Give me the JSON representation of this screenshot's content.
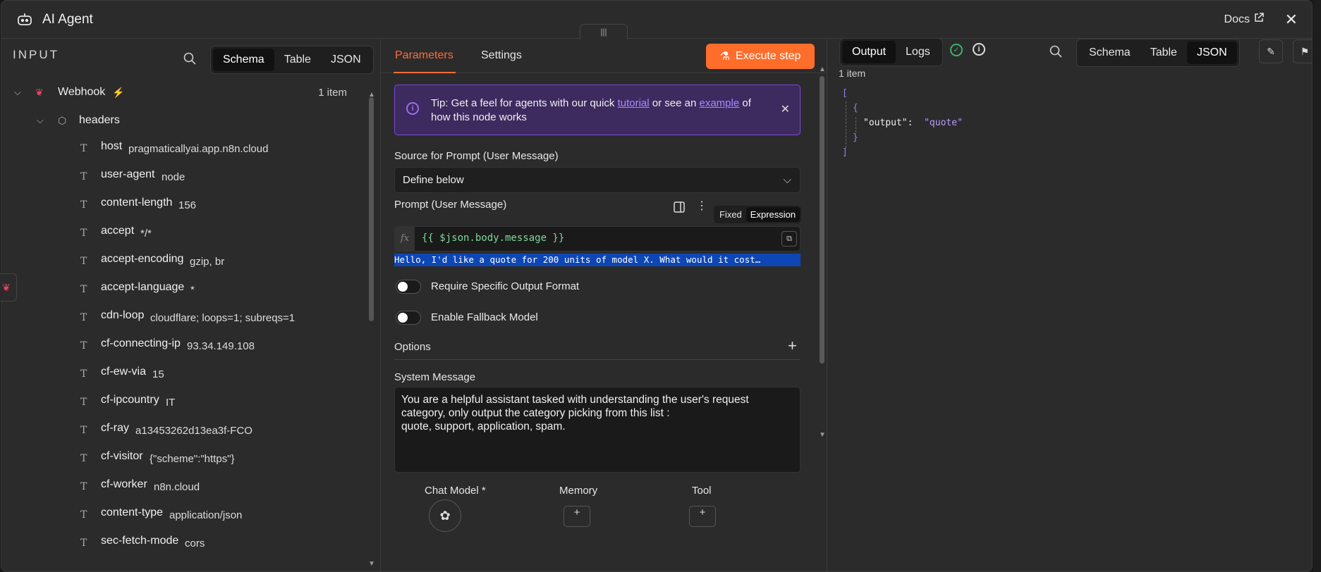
{
  "header": {
    "title": "AI Agent",
    "docs_label": "Docs"
  },
  "input": {
    "heading": "INPUT",
    "view_tabs": [
      "Schema",
      "Table",
      "JSON"
    ],
    "active_view": "Schema",
    "root": {
      "name": "Webhook",
      "count": "1 item"
    },
    "group": "headers",
    "fields": [
      {
        "key": "host",
        "value": "pragmaticallyai.app.n8n.cloud"
      },
      {
        "key": "user-agent",
        "value": "node"
      },
      {
        "key": "content-length",
        "value": "156"
      },
      {
        "key": "accept",
        "value": "*/*"
      },
      {
        "key": "accept-encoding",
        "value": "gzip, br"
      },
      {
        "key": "accept-language",
        "value": "*"
      },
      {
        "key": "cdn-loop",
        "value": "cloudflare; loops=1; subreqs=1"
      },
      {
        "key": "cf-connecting-ip",
        "value": "93.34.149.108"
      },
      {
        "key": "cf-ew-via",
        "value": "15"
      },
      {
        "key": "cf-ipcountry",
        "value": "IT"
      },
      {
        "key": "cf-ray",
        "value": "a13453262d13ea3f-FCO"
      },
      {
        "key": "cf-visitor",
        "value": "{\"scheme\":\"https\"}"
      },
      {
        "key": "cf-worker",
        "value": "n8n.cloud"
      },
      {
        "key": "content-type",
        "value": "application/json"
      },
      {
        "key": "sec-fetch-mode",
        "value": "cors"
      }
    ]
  },
  "params": {
    "tabs": [
      "Parameters",
      "Settings"
    ],
    "execute_label": "Execute step",
    "tip": {
      "prefix": "Tip: Get a feel for agents with our quick ",
      "link1": "tutorial",
      "middle": " or see an ",
      "link2": "example",
      "suffix": " of how this node works"
    },
    "source_label": "Source for Prompt (User Message)",
    "source_value": "Define below",
    "prompt_label": "Prompt (User Message)",
    "mode_fixed": "Fixed",
    "mode_expression": "Expression",
    "fx": "fx",
    "expression": "{{ $json.body.message }}",
    "preview": "Hello, I'd like a quote for 200 units of model X. What would it cost…",
    "toggle1": "Require Specific Output Format",
    "toggle2": "Enable Fallback Model",
    "options_label": "Options",
    "system_label": "System Message",
    "system_text": "You are a helpful assistant tasked with understanding the user's request category, only output the category picking from this list :\nquote, support, application, spam.",
    "chat_model_label": "Chat Model *",
    "memory_label": "Memory",
    "tool_label": "Tool"
  },
  "output": {
    "tabs": [
      "Output",
      "Logs"
    ],
    "active_tab": "Output",
    "view_tabs": [
      "Schema",
      "Table",
      "JSON"
    ],
    "active_view": "JSON",
    "count": "1 item",
    "json_key": "\"output\":",
    "json_value": "\"quote\""
  }
}
